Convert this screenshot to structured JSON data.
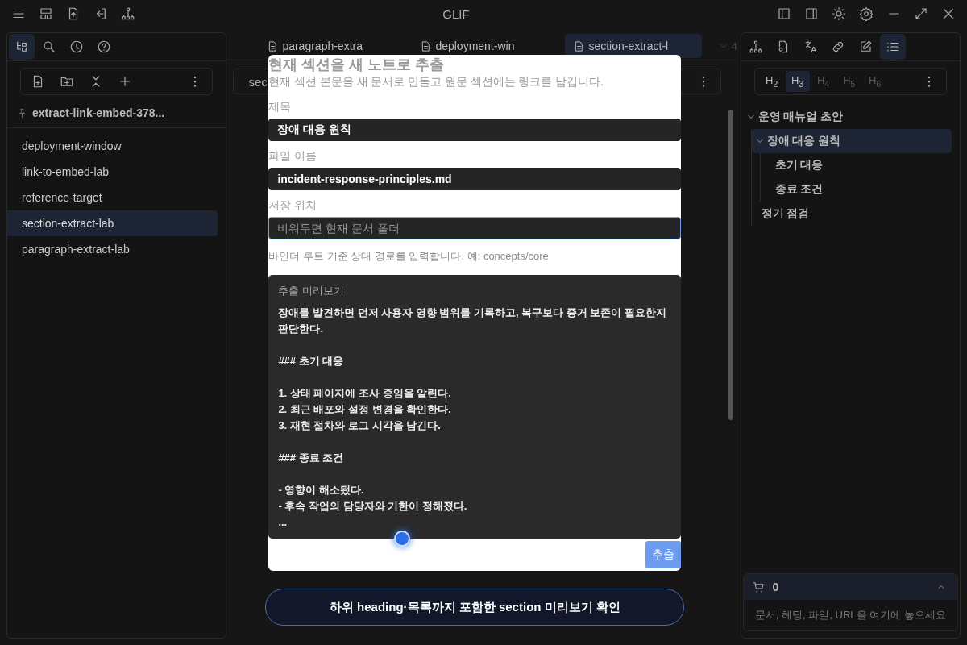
{
  "window": {
    "title": "GLIF"
  },
  "left_panel": {
    "view_tabs": [
      {
        "selected": true
      },
      {
        "selected": false
      },
      {
        "selected": false
      },
      {
        "selected": false
      }
    ],
    "pinned": "extract-link-embed-378...",
    "files": [
      {
        "label": "deployment-window",
        "selected": false
      },
      {
        "label": "link-to-embed-lab",
        "selected": false
      },
      {
        "label": "reference-target",
        "selected": false
      },
      {
        "label": "section-extract-lab",
        "selected": true
      },
      {
        "label": "paragraph-extract-lab",
        "selected": false
      }
    ]
  },
  "editor": {
    "tabs": [
      {
        "label": "paragraph-extra",
        "selected": false
      },
      {
        "label": "deployment-win",
        "selected": false
      },
      {
        "label": "section-extract-l",
        "selected": true
      }
    ],
    "tab_count": "4",
    "doc_title": "sec"
  },
  "right_panel": {
    "view_tabs": [
      {
        "selected": false
      },
      {
        "selected": false
      },
      {
        "selected": false
      },
      {
        "selected": false
      },
      {
        "selected": false
      },
      {
        "selected": true
      }
    ],
    "heading_levels": [
      {
        "label": "H$_{2}$",
        "selected": false,
        "disabled": false
      },
      {
        "label": "H$_{3}$",
        "selected": true,
        "disabled": false
      },
      {
        "label": "H$_{4}$",
        "selected": false,
        "disabled": true
      },
      {
        "label": "H$_{5}$",
        "selected": false,
        "disabled": true
      },
      {
        "label": "H$_{6}$",
        "selected": false,
        "disabled": true
      }
    ],
    "outline": [
      {
        "label": "운영 매뉴얼 초안",
        "selected": false,
        "expanded": true,
        "children": [
          {
            "label": "장애 대응 원칙",
            "selected": true,
            "expanded": true,
            "children": [
              {
                "label": "초기 대응",
                "selected": false
              },
              {
                "label": "종료 조건",
                "selected": false
              }
            ]
          },
          {
            "label": "정기 점검",
            "selected": false
          }
        ]
      }
    ],
    "basket": {
      "count": "0",
      "hint": "문서, 헤딩, 파일, URL을 여기에 놓으세요"
    }
  },
  "dialog": {
    "title": "현재 섹션을 새 노트로 추출",
    "description": "현재 섹션 본문을 새 문서로 만들고 원문 섹션에는 링크를 남깁니다.",
    "fields": [
      {
        "label": "제목",
        "value": "장애 대응 원칙",
        "focused": false
      },
      {
        "label": "파일 이름",
        "value": "incident-response-principles.md",
        "focused": false
      },
      {
        "label": "저장 위치",
        "placeholder": "비워두면 현재 문서 폴더",
        "focused": true
      }
    ],
    "hint": "바인더 루트 기준 상대 경로를 입력합니다. 예: concepts/core",
    "preview_label": "추출 미리보기",
    "preview": [
      "장애를 발견하면 먼저 사용자 영향 범위를 기록하고, 복구보다 증거 보존이 필요한지 판단한다.",
      "### 초기 대응",
      "1. 상태 페이지에 조사 중임을 알린다.\n2. 최근 배포와 설정 변경을 확인한다.\n3. 재현 절차와 로그 시각을 남긴다.",
      "### 종료 조건",
      "- 영향이 해소됐다.\n- 후속 작업의 담당자와 기한이 정해졌다.\n..."
    ],
    "submit": "추출"
  },
  "toast": "하위 heading·목록까지 포함한 section 미리보기 확인"
}
